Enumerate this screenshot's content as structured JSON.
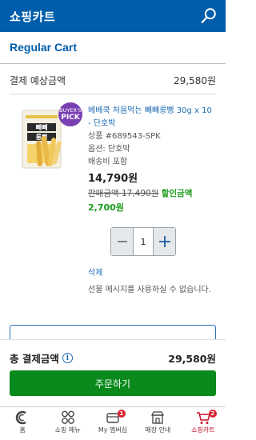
{
  "header": {
    "title": "쇼핑카트",
    "search_icon": "search-icon"
  },
  "cart": {
    "title": "Regular Cart"
  },
  "estimate": {
    "label": "결제 예상금액",
    "value": "29,580원"
  },
  "item": {
    "badge_line1": "BUYER'S",
    "badge_line2": "PICK",
    "package_top": "빼빼",
    "package_bottom": "롱뻥",
    "name": "베베쿡 처음먹는 빼빼롱뻥 30g x 10 - 단호박",
    "product_code": "상품 #689543-SPK",
    "option": "옵션: 단호박",
    "shipping": "배송비 포함",
    "price": "14,790원",
    "original_price": "판매금액 17,490원",
    "discount_label": "할인금액",
    "discount_amount": "2,700원",
    "quantity": "1",
    "delete_label": "삭제",
    "gift_message": "선물 메시지를 사용하실 수 없습니다."
  },
  "summary": {
    "total_label": "총 결제금액",
    "total_value": "29,580원",
    "order_button": "주문하기"
  },
  "tabs": [
    {
      "label": "홈",
      "icon": "costco-c-icon"
    },
    {
      "label": "쇼핑 메뉴",
      "icon": "grid-icon"
    },
    {
      "label": "My 멤버십",
      "icon": "wallet-icon",
      "badge": "1"
    },
    {
      "label": "매장 안내",
      "icon": "store-icon"
    },
    {
      "label": "쇼핑카트",
      "icon": "cart-icon",
      "badge": "2"
    }
  ],
  "colors": {
    "brand_blue": "#005dab",
    "link_blue": "#1f6cb5",
    "discount_green": "#1a9a1a",
    "order_green": "#0a8a1c",
    "active_red": "#c8102e"
  }
}
